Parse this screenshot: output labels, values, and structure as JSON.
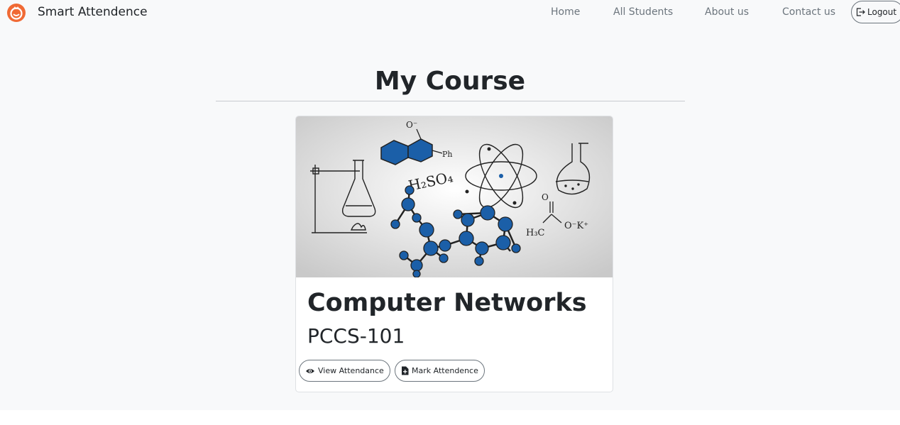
{
  "navbar": {
    "brand": "Smart Attendence",
    "links": [
      "Home",
      "All Students",
      "About us",
      "Contact us"
    ],
    "logout_label": "Logout"
  },
  "page_title": "My Course",
  "course_card": {
    "name": "Computer Networks",
    "code": "PCCS-101",
    "view_button_label": "View Attendance",
    "mark_button_label": "Mark Attendence",
    "image_labels": {
      "o_minus": "O⁻",
      "ph": "Ph",
      "h2so4": "H₂SO₄",
      "o": "O",
      "h3c": "H₃C",
      "ok": "O⁻K⁺"
    }
  },
  "colors": {
    "brand_accent": "#f06a35",
    "molecule_blue": "#1b5fa8",
    "background": "#f8f9fa"
  }
}
